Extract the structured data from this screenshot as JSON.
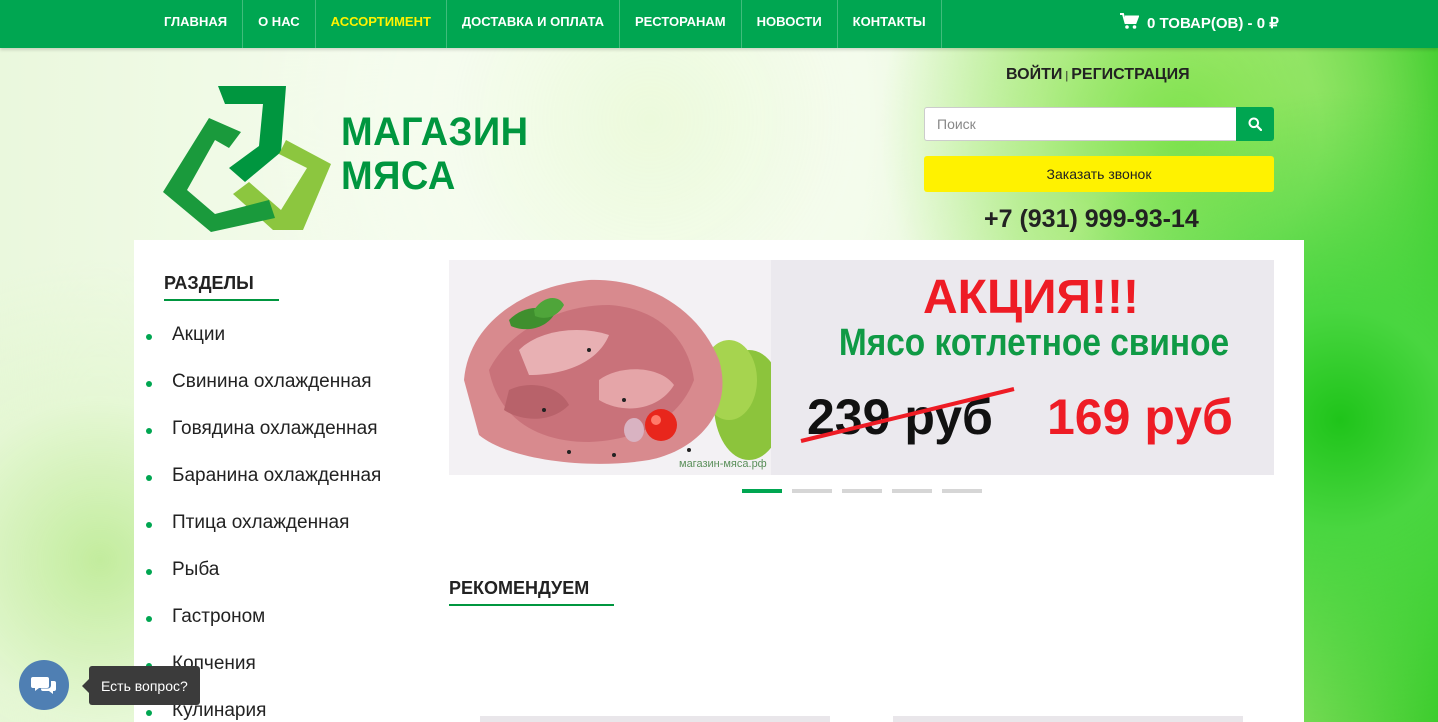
{
  "nav": {
    "items": [
      "ГЛАВНАЯ",
      "О НАС",
      "АССОРТИМЕНТ",
      "ДОСТАВКА И ОПЛАТА",
      "РЕСТОРАНАМ",
      "НОВОСТИ",
      "КОНТАКТЫ"
    ],
    "active": "АССОРТИМЕНТ",
    "cart_label": "0 ТОВАР(ОВ) - 0 ₽"
  },
  "header": {
    "logo_line1": "МАГАЗИН",
    "logo_line2": "МЯСА",
    "login": "ВОЙТИ",
    "separator": "|",
    "register": "РЕГИСТРАЦИЯ",
    "search_placeholder": "Поиск",
    "callback_label": "Заказать звонок",
    "phone": "+7 (931) 999-93-14"
  },
  "sidebar": {
    "title": "РАЗДЕЛЫ",
    "items": [
      "Акции",
      "Свинина охлажденная",
      "Говядина охлажденная",
      "Баранина охлажденная",
      "Птица охлажденная",
      "Рыба",
      "Гастроном",
      "Копчения",
      "Кулинария"
    ]
  },
  "banner": {
    "headline": "АКЦИЯ!!!",
    "product": "Мясо котлетное свиное",
    "old_price": "239 руб",
    "new_price": "169 руб",
    "site": "магазин-мяса.рф",
    "slides": 5,
    "active_slide": 1
  },
  "recommend": {
    "title": "РЕКОМЕНДУЕМ"
  },
  "chat": {
    "tooltip": "Есть вопрос?"
  },
  "colors": {
    "brand_green": "#00a651",
    "active_nav": "#fff200",
    "price_red": "#ee1c25",
    "callback_yellow": "#fff200"
  }
}
